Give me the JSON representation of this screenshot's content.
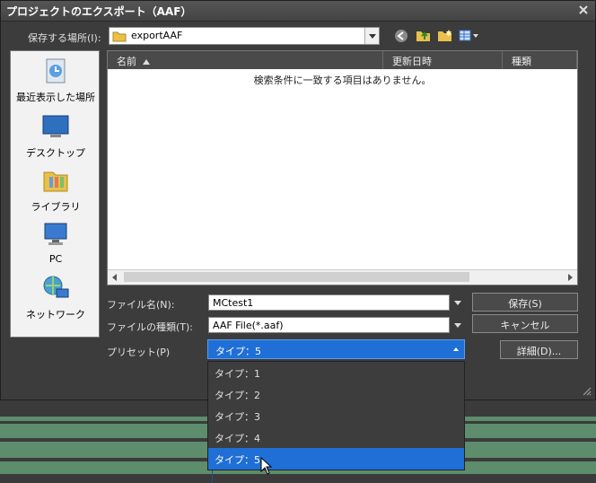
{
  "dialog": {
    "title": "プロジェクトのエクスポート（AAF）",
    "location_label": "保存する場所(I):",
    "location_value": "exportAAF"
  },
  "places": [
    {
      "label": "最近表示した場所",
      "icon": "recent-places-icon"
    },
    {
      "label": "デスクトップ",
      "icon": "desktop-icon"
    },
    {
      "label": "ライブラリ",
      "icon": "library-icon"
    },
    {
      "label": "PC",
      "icon": "pc-icon"
    },
    {
      "label": "ネットワーク",
      "icon": "network-icon"
    }
  ],
  "filelist": {
    "columns": {
      "name": "名前",
      "modified": "更新日時",
      "type": "種類"
    },
    "empty_message": "検索条件に一致する項目はありません。"
  },
  "form": {
    "filename_label": "ファイル名(N):",
    "filename_value": "MCtest1",
    "filetype_label": "ファイルの種類(T):",
    "filetype_value": "AAF File(*.aaf)",
    "preset_label": "プリセット(P)",
    "preset_value": "タイプ：5"
  },
  "buttons": {
    "save": "保存(S)",
    "cancel": "キャンセル",
    "details": "詳細(D)..."
  },
  "preset_options": [
    "タイプ：1",
    "タイプ：2",
    "タイプ：3",
    "タイプ：4",
    "タイプ：5"
  ],
  "selected_preset_index": 4,
  "colors": {
    "accent": "#1f6fd6",
    "dialog_bg": "#3c3c3c",
    "timeline_clip": "#5d8d6c"
  }
}
